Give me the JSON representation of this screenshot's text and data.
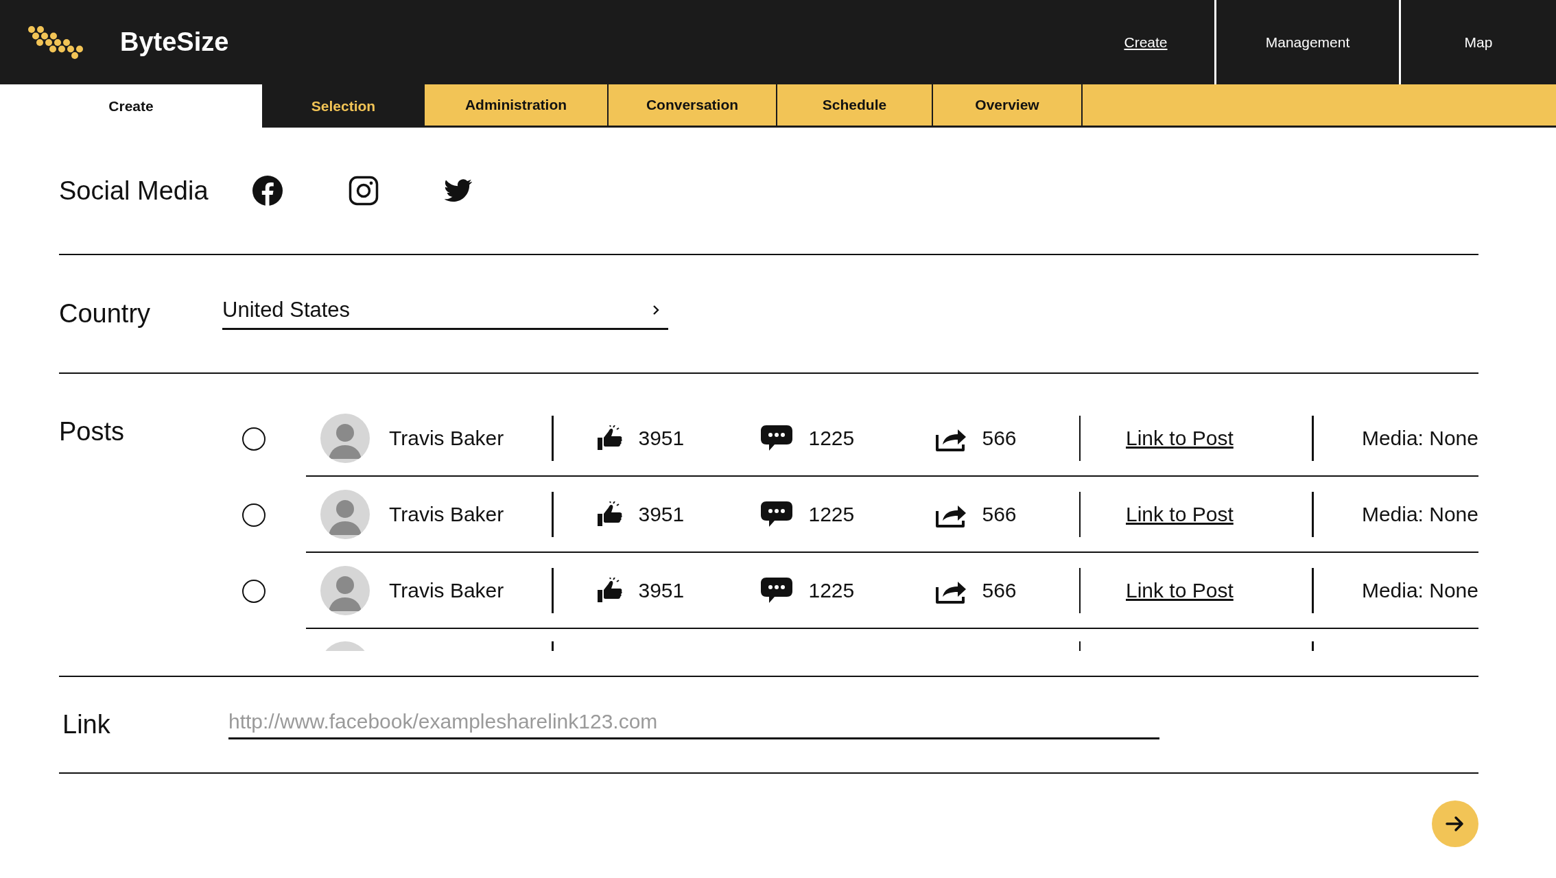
{
  "header": {
    "brand": "ByteSize",
    "nav": [
      {
        "label": "Create",
        "selected": true
      },
      {
        "label": "Management",
        "selected": false
      },
      {
        "label": "Map",
        "selected": false
      }
    ]
  },
  "tabs": [
    {
      "label": "Create",
      "kind": "light",
      "selected": false
    },
    {
      "label": "Selection",
      "kind": "dark",
      "selected": true
    },
    {
      "label": "Administration",
      "kind": "accent",
      "selected": false
    },
    {
      "label": "Conversation",
      "kind": "accent",
      "selected": false
    },
    {
      "label": "Schedule",
      "kind": "accent",
      "selected": false
    },
    {
      "label": "Overview",
      "kind": "accent",
      "selected": false
    }
  ],
  "social_media": {
    "label": "Social Media"
  },
  "country": {
    "label": "Country",
    "value": "United States"
  },
  "posts": {
    "label": "Posts",
    "rows": [
      {
        "selected": false,
        "name": "Travis Baker",
        "likes": "3951",
        "comments": "1225",
        "shares": "566",
        "link": "Link to Post",
        "media": "Media: None"
      },
      {
        "selected": false,
        "name": "Travis Baker",
        "likes": "3951",
        "comments": "1225",
        "shares": "566",
        "link": "Link to Post",
        "media": "Media: None"
      },
      {
        "selected": false,
        "name": "Travis Baker",
        "likes": "3951",
        "comments": "1225",
        "shares": "566",
        "link": "Link to Post",
        "media": "Media: None"
      }
    ]
  },
  "link": {
    "label": "Link",
    "placeholder": "http://www.facebook/examplesharelink123.com"
  }
}
